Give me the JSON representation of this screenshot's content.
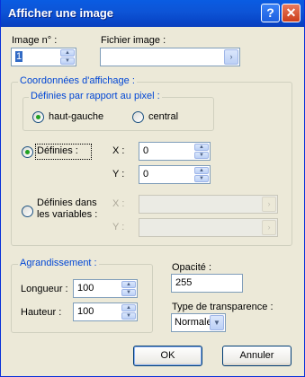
{
  "window": {
    "title": "Afficher une image",
    "help_label": "?",
    "close_label": "✕"
  },
  "image_number": {
    "label": "Image n° :",
    "value": "1"
  },
  "image_file": {
    "label": "Fichier image :",
    "value": ""
  },
  "display_coords": {
    "legend": "Coordonnées d'affichage :",
    "pixel_ref": {
      "legend": "Définies par rapport au pixel :",
      "options": [
        "haut-gauche",
        "central"
      ],
      "selected": "haut-gauche"
    },
    "defined": {
      "label": "Définies :",
      "x_label": "X :",
      "x_value": "0",
      "y_label": "Y :",
      "y_value": "0"
    },
    "in_variables": {
      "label_line1": "Définies dans",
      "label_line2": "les variables :",
      "x_label": "X :",
      "x_value": "",
      "y_label": "Y :",
      "y_value": ""
    }
  },
  "enlargement": {
    "legend": "Agrandissement :",
    "width_label": "Longueur :",
    "width_value": "100",
    "height_label": "Hauteur :",
    "height_value": "100"
  },
  "opacity": {
    "label": "Opacité :",
    "value": "255"
  },
  "transparency": {
    "label": "Type de transparence :",
    "value": "Normale"
  },
  "buttons": {
    "ok": "OK",
    "cancel": "Annuler"
  },
  "icons": {
    "spin_up": "▲",
    "spin_down": "▼",
    "browse": "›",
    "dropdown": "▼"
  },
  "colors": {
    "title_bar": "#0a5ce2",
    "group_legend": "#0046d5",
    "dialog_bg": "#ece9d8",
    "radio_dot": "#21a121"
  }
}
